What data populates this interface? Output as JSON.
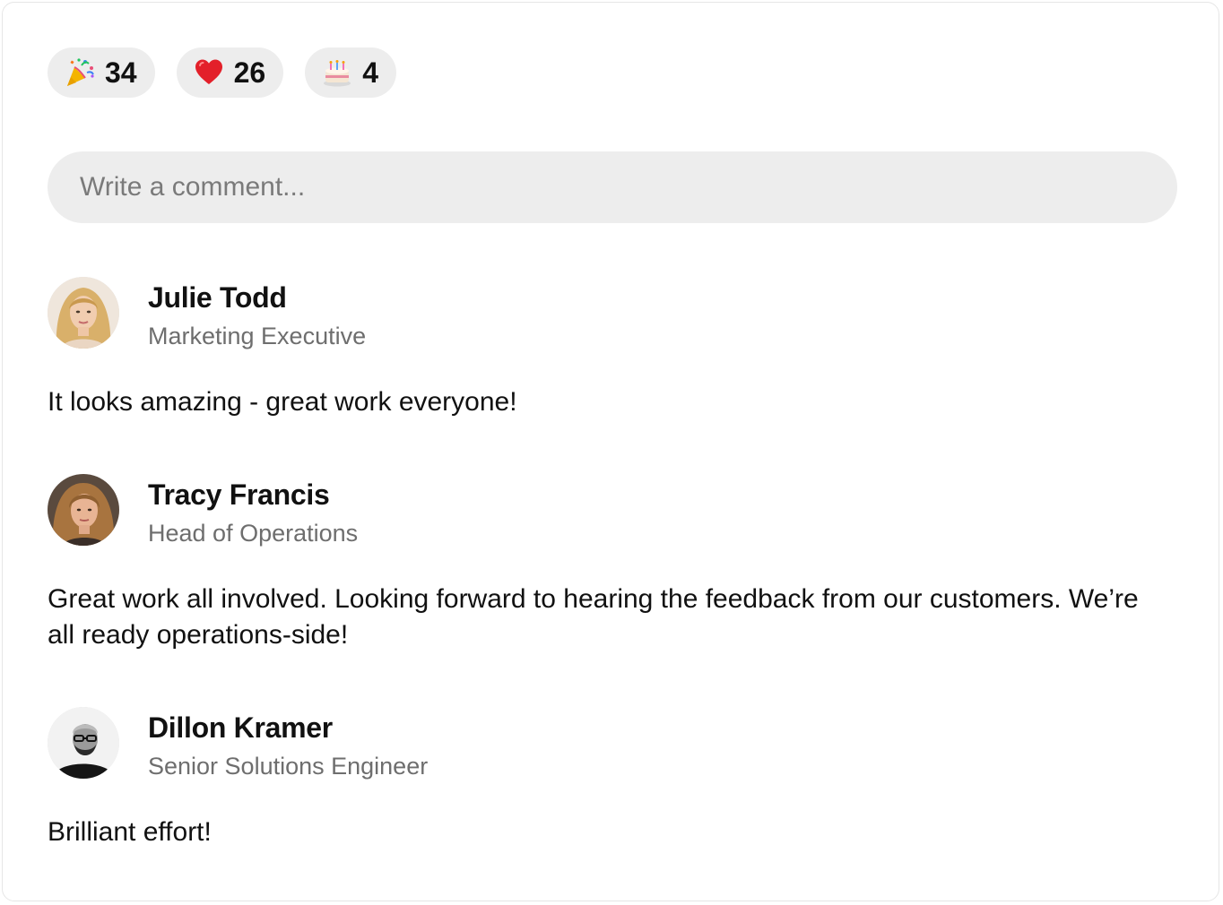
{
  "reactions": [
    {
      "emoji": "party-popper",
      "count": "34"
    },
    {
      "emoji": "red-heart",
      "count": "26"
    },
    {
      "emoji": "birthday-cake",
      "count": "4"
    }
  ],
  "comment_box": {
    "placeholder": "Write a comment..."
  },
  "comments": [
    {
      "author": "Julie Todd",
      "role": "Marketing Executive",
      "text": "It looks amazing - great work everyone!"
    },
    {
      "author": "Tracy Francis",
      "role": "Head of Operations",
      "text": "Great work all involved. Looking forward to hearing the feedback from our customers. We’re all ready operations-side!"
    },
    {
      "author": "Dillon Kramer",
      "role": "Senior Solutions Engineer",
      "text": "Brilliant effort!"
    }
  ]
}
